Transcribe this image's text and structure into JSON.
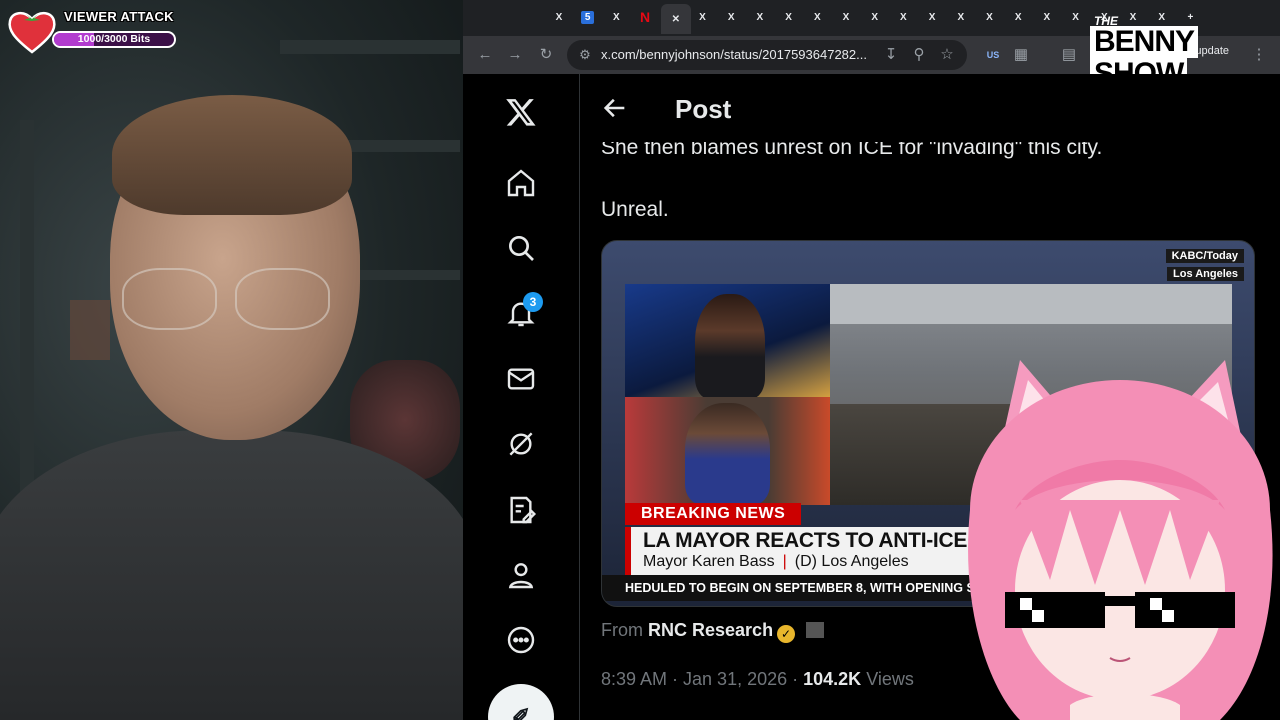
{
  "overlay": {
    "viewer_attack_title": "VIEWER ATTACK",
    "bits_progress_text": "1000/3000 Bits",
    "bits_progress_fraction": 0.333,
    "logo": {
      "the": "THE",
      "line1": "BENNY",
      "line2": "SHOW"
    }
  },
  "browser": {
    "tabs": [
      {
        "icon": "x-icon",
        "glyph": "X"
      },
      {
        "icon": "five-icon",
        "glyph": "5"
      },
      {
        "icon": "x-icon",
        "glyph": "X"
      },
      {
        "icon": "netflix-icon",
        "glyph": "N"
      },
      {
        "icon": "close-icon",
        "glyph": "✕"
      },
      {
        "icon": "x-icon",
        "glyph": "X"
      },
      {
        "icon": "x-icon",
        "glyph": "X"
      },
      {
        "icon": "x-icon",
        "glyph": "X"
      },
      {
        "icon": "x-icon",
        "glyph": "X"
      },
      {
        "icon": "x-icon",
        "glyph": "X"
      },
      {
        "icon": "x-icon",
        "glyph": "X"
      },
      {
        "icon": "x-icon",
        "glyph": "X"
      },
      {
        "icon": "x-icon",
        "glyph": "X"
      },
      {
        "icon": "x-icon",
        "glyph": "X"
      },
      {
        "icon": "x-icon",
        "glyph": "X"
      },
      {
        "icon": "x-icon",
        "glyph": "X"
      },
      {
        "icon": "x-icon",
        "glyph": "X"
      },
      {
        "icon": "x-icon",
        "glyph": "X"
      },
      {
        "icon": "x-icon",
        "glyph": "X"
      },
      {
        "icon": "x-icon",
        "glyph": "X"
      },
      {
        "icon": "x-icon",
        "glyph": "X"
      },
      {
        "icon": "x-icon",
        "glyph": "X"
      },
      {
        "icon": "new-tab-icon",
        "glyph": "+"
      }
    ],
    "url": "x.com/bennyjohnson/status/2017593647282...",
    "finish_update": "Finish update",
    "ext_badge": "US"
  },
  "x": {
    "nav": [
      "x-logo-icon",
      "home-icon",
      "search-icon",
      "notifications-icon",
      "messages-icon",
      "grok-icon",
      "lists-icon",
      "profile-icon",
      "more-icon"
    ],
    "notification_count": "3",
    "header_title": "Post",
    "tweet_lines": [
      "She then blames unrest on ICE for \"invading\" this city.",
      "Unreal."
    ],
    "media": {
      "tag1": "KABC/Today",
      "tag2": "Los Angeles",
      "breaking": "BREAKING NEWS",
      "headline": "LA MAYOR REACTS TO ANTI-ICE PROTESTS ERU",
      "sub_name": "Mayor Karen Bass",
      "sub_party": "(D) Los Angeles",
      "ticker": "HEDULED TO BEGIN ON SEPTEMBER 8, WITH OPENING ST"
    },
    "from_prefix": "From",
    "from_name": "RNC Research",
    "meta_time": "8:39 AM · Jan 31, 2026 ·",
    "meta_views_count": "104.2K",
    "meta_views_label": "Views"
  },
  "colors": {
    "x_blue": "#1d9bf0",
    "breaking_red": "#cc0000",
    "bits_purple": "#b23ccf"
  }
}
